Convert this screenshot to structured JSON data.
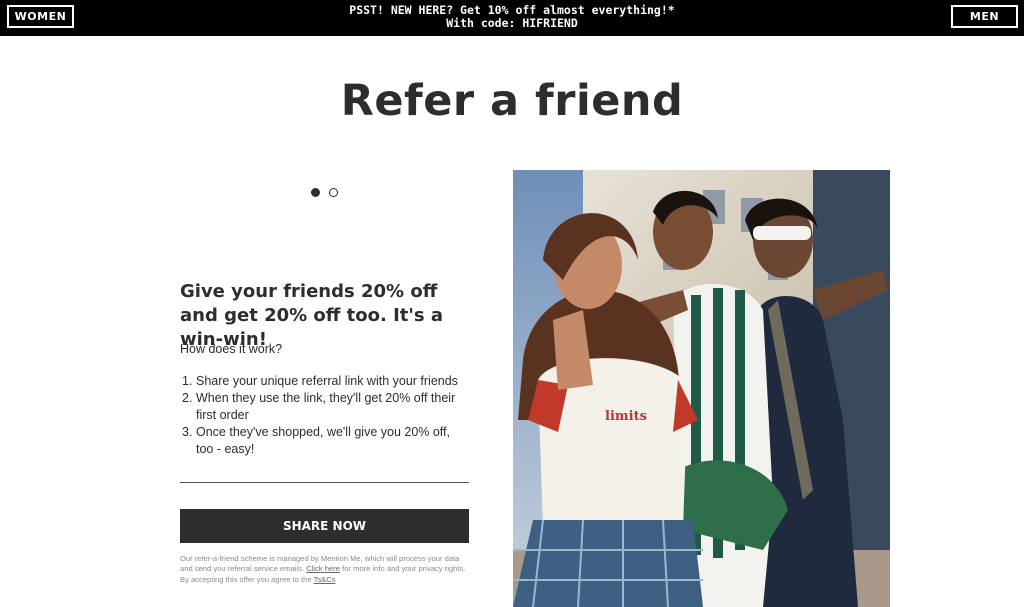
{
  "topbar": {
    "women_label": "WOMEN",
    "men_label": "MEN",
    "promo_line1": "PSST! NEW HERE? Get 10% off almost everything!*",
    "promo_line2": "With code: HIFRIEND"
  },
  "page": {
    "title": "Refer a friend"
  },
  "carousel": {
    "slide_count": 2,
    "active_index": 0
  },
  "offer": {
    "headline": "Give your friends 20% off and get 20% off too. It's a win-win!",
    "how_label": "How does it work?",
    "steps": [
      "Share your unique referral link with your friends",
      "When they use the link, they'll get 20% off their first order",
      "Once they've shopped, we'll give you 20% off, too - easy!"
    ],
    "share_button": "SHARE NOW",
    "fine_print_1": "Our refer-a-friend scheme is managed by Mention Me, which will process your data and send you referral service emails.",
    "click_here": "Click here",
    "fine_print_2": "for more info and your privacy rights. By accepting this offer you agree to the",
    "tcs_link": "Ts&Cs"
  },
  "hero_image": {
    "icon": "photo-friends-laughing"
  }
}
